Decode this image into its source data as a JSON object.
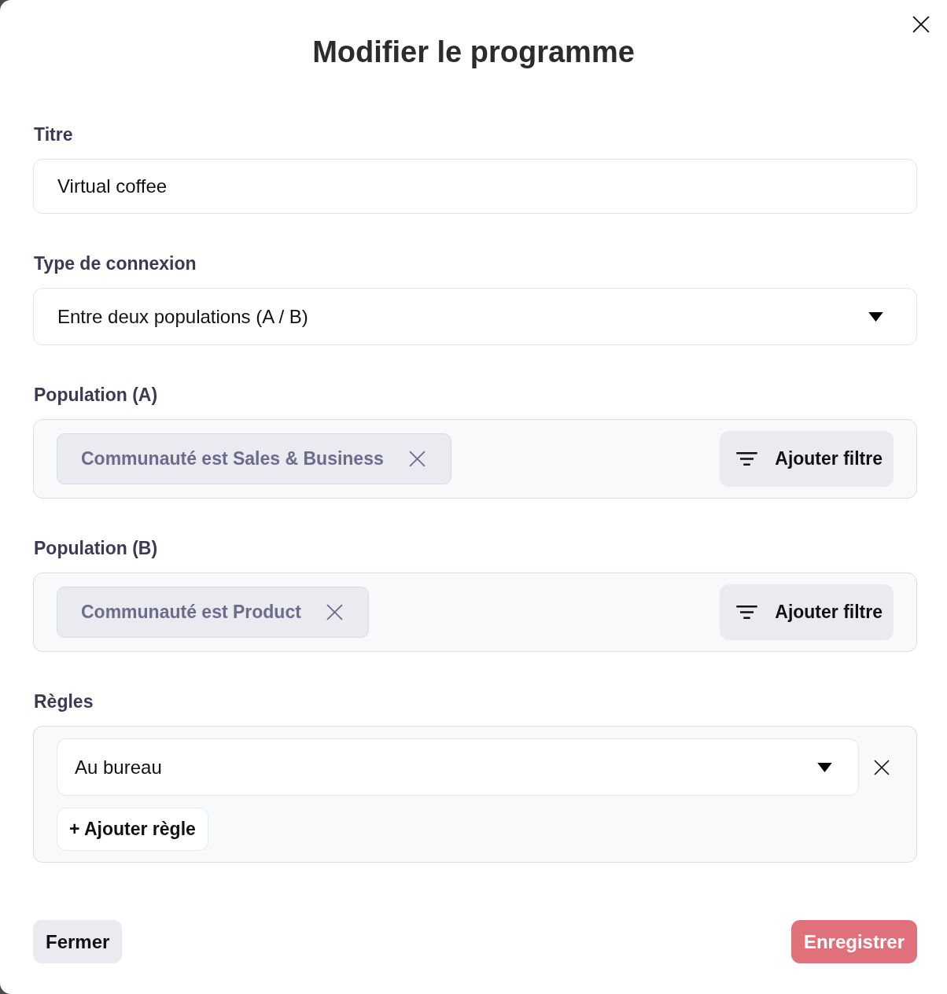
{
  "dialog": {
    "title": "Modifier le programme"
  },
  "fields": [
    {
      "kind": "text",
      "label": "Titre",
      "value": "Virtual coffee"
    },
    {
      "kind": "select",
      "label": "Type de connexion",
      "value": "Entre deux populations (A / B)"
    },
    {
      "kind": "filters",
      "label": "Population (A)",
      "chips": [
        "Communauté est Sales & Business"
      ],
      "button": "Ajouter filtre"
    },
    {
      "kind": "filters",
      "label": "Population (B)",
      "chips": [
        "Communauté est Product"
      ],
      "button": "Ajouter filtre"
    },
    {
      "kind": "rules",
      "label": "Règles",
      "rules": [
        "Au bureau"
      ],
      "button": "+ Ajouter règle"
    }
  ],
  "footer": {
    "buttons": [
      {
        "kind": "secondary",
        "label": "Fermer"
      },
      {
        "kind": "primary",
        "label": "Enregistrer"
      }
    ]
  }
}
